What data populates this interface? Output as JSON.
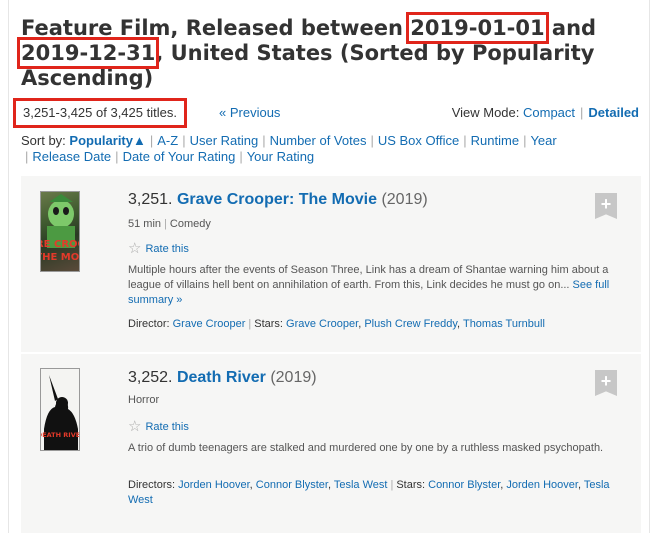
{
  "header": {
    "title_part1": "Feature Film, Released between ",
    "date_from": "2019-01-01",
    "title_part2": " and ",
    "date_to": "2019-12-31",
    "title_part3": ", United States (Sorted by Popularity Ascending)"
  },
  "pagination": {
    "count": "3,251-3,425 of 3,425 titles.",
    "previous": "« Previous"
  },
  "view_mode": {
    "label": "View Mode:",
    "compact": "Compact",
    "detailed": "Detailed",
    "separator": "|"
  },
  "sort": {
    "label": "Sort by:",
    "options": [
      "Popularity▲",
      "A-Z",
      "User Rating",
      "Number of Votes",
      "US Box Office",
      "Runtime",
      "Year",
      "Release Date",
      "Date of Your Rating",
      "Your Rating"
    ]
  },
  "items": [
    {
      "index": "3,251.",
      "title": "Grave Crooper: The Movie",
      "year": "(2019)",
      "runtime": "51 min",
      "genre": "Comedy",
      "rate_label": "Rate this",
      "summary": "Multiple hours after the events of Season Three, Link has a dream of Shantae warning him about a league of villains hell bent on annihilation of earth. From this, Link decides he must go on...",
      "see_full": "See full summary »",
      "director_label": "Director:",
      "directors": [
        "Grave Crooper"
      ],
      "stars_label": "Stars:",
      "stars": [
        "Grave Crooper",
        "Plush Crew Freddy",
        "Thomas Turnbull"
      ],
      "poster_text": "RE CROO THE MOV"
    },
    {
      "index": "3,252.",
      "title": "Death River",
      "year": "(2019)",
      "genre": "Horror",
      "rate_label": "Rate this",
      "summary": "A trio of dumb teenagers are stalked and murdered one by one by a ruthless masked psychopath.",
      "director_label": "Directors:",
      "directors": [
        "Jorden Hoover",
        "Connor Blyster",
        "Tesla West"
      ],
      "stars_label": "Stars:",
      "stars": [
        "Connor Blyster",
        "Jorden Hoover",
        "Tesla West"
      ],
      "poster_text": "DEATH RIVER"
    }
  ],
  "icons": {
    "add": "plus-icon",
    "star": "star-outline-icon"
  },
  "colors": {
    "link": "#136cb2",
    "highlight": "#e0251b",
    "item_bg": "#f6f6f5"
  },
  "glyphs": {
    "plus": "+",
    "star": "☆",
    "pipe": "|",
    "comma": ",",
    "space": " "
  }
}
